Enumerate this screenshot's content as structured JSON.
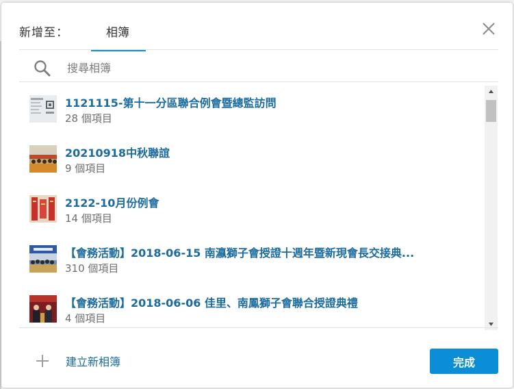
{
  "header": {
    "label": "新增至：",
    "tab_label": "相簿"
  },
  "search": {
    "placeholder": "搜尋相簿",
    "value": ""
  },
  "albums": [
    {
      "title": "1121115-第十一分區聯合例會暨總監訪問",
      "count": "28 個項目",
      "thumb": "document"
    },
    {
      "title": "20210918中秋聯誼",
      "count": "9 個項目",
      "thumb": "group-photo"
    },
    {
      "title": "2122-10月份例會",
      "count": "14 個項目",
      "thumb": "red-banner"
    },
    {
      "title": "【會務活動】2018-06-15 南瀛獅子會授證十週年暨新現會長交接典...",
      "count": "310 個項目",
      "thumb": "ceremony"
    },
    {
      "title": "【會務活動】2018-06-06 佳里、南鳳獅子會聯合授證典禮",
      "count": "4 個項目",
      "thumb": "group-red"
    }
  ],
  "footer": {
    "create_label": "建立新相簿",
    "done_label": "完成"
  },
  "icons": {
    "close": "close-icon",
    "search": "search-icon",
    "plus": "plus-icon"
  },
  "colors": {
    "accent": "#0b8ed6",
    "link": "#1b6b9e",
    "muted": "#6e6e6e"
  }
}
